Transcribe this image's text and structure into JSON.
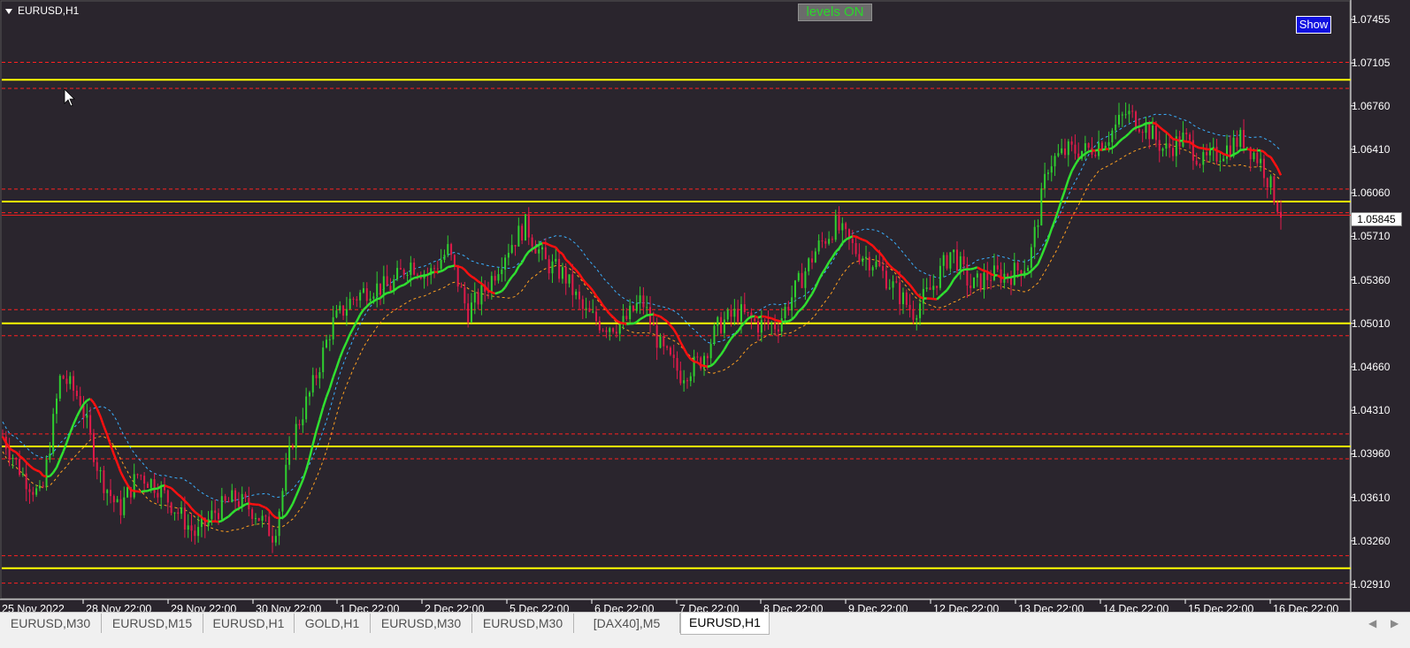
{
  "window": {
    "symbol_title": "EURUSD,H1"
  },
  "buttons": {
    "levels_label": "levels ON",
    "show_label": "Show"
  },
  "price_axis": {
    "labels": [
      "1.07455",
      "1.07105",
      "1.06760",
      "1.06410",
      "1.06060",
      "1.05710",
      "1.05360",
      "1.05010",
      "1.04660",
      "1.04310",
      "1.03960",
      "1.03610",
      "1.03260",
      "1.02910"
    ],
    "current_price": "1.05845"
  },
  "time_axis": {
    "labels": [
      "25 Nov 2022",
      "28 Nov 22:00",
      "29 Nov 22:00",
      "30 Nov 22:00",
      "1 Dec 22:00",
      "2 Dec 22:00",
      "5 Dec 22:00",
      "6 Dec 22:00",
      "7 Dec 22:00",
      "8 Dec 22:00",
      "9 Dec 22:00",
      "12 Dec 22:00",
      "13 Dec 22:00",
      "14 Dec 22:00",
      "15 Dec 22:00",
      "16 Dec 22:00"
    ]
  },
  "levels": {
    "yellow": [
      1.0697,
      1.0599,
      1.0501,
      1.0402,
      1.0304
    ],
    "red_dashed": [
      1.0711,
      1.069,
      1.0609,
      1.059,
      1.0512,
      1.0491,
      1.0412,
      1.0392,
      1.0314,
      1.0292
    ],
    "red_solid": [
      1.0588
    ]
  },
  "colors": {
    "background": "#2a252d",
    "level_yellow": "#ffff00",
    "level_red": "#ff2020",
    "candle_bull": "#2fd02f",
    "candle_bear": "#e01a4a",
    "ma_up": "#30e030",
    "ma_down": "#ff1010",
    "band_upper": "#3ab0ff",
    "band_lower": "#ffa020"
  },
  "chart_data": {
    "type": "candlestick",
    "symbol": "EURUSD",
    "timeframe": "H1",
    "ylim": [
      1.0284,
      1.0752
    ],
    "path_close": [
      1.041,
      1.038,
      1.036,
      1.046,
      1.044,
      1.038,
      1.035,
      1.038,
      1.037,
      1.035,
      1.033,
      1.035,
      1.036,
      1.035,
      1.033,
      1.041,
      1.045,
      1.05,
      1.052,
      1.053,
      1.053,
      1.055,
      1.054,
      1.056,
      1.051,
      1.053,
      1.056,
      1.058,
      1.055,
      1.054,
      1.051,
      1.05,
      1.05,
      1.052,
      1.048,
      1.046,
      1.047,
      1.05,
      1.051,
      1.05,
      1.05,
      1.053,
      1.056,
      1.058,
      1.056,
      1.055,
      1.053,
      1.051,
      1.053,
      1.056,
      1.053,
      1.054,
      1.054,
      1.055,
      1.063,
      1.064,
      1.064,
      1.065,
      1.067,
      1.066,
      1.064,
      1.065,
      1.063,
      1.064,
      1.065,
      1.063,
      1.059
    ]
  },
  "tabs": [
    {
      "label": "EURUSD,M30"
    },
    {
      "label": "EURUSD,M15"
    },
    {
      "label": "EURUSD,H1"
    },
    {
      "label": "GOLD,H1"
    },
    {
      "label": "EURUSD,M30"
    },
    {
      "label": "EURUSD,M30"
    },
    {
      "label": "[DAX40],M5"
    },
    {
      "label": "EURUSD,H1"
    }
  ]
}
